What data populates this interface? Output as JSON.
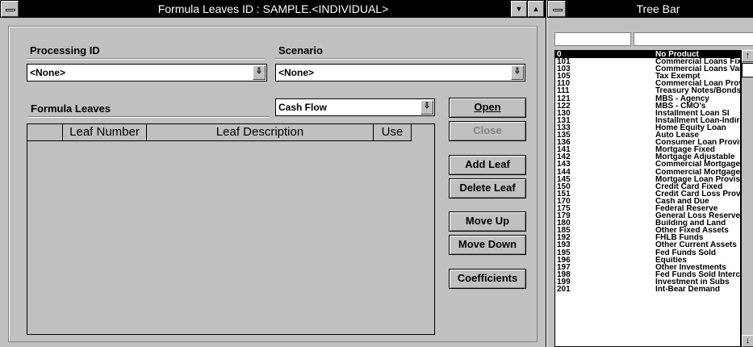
{
  "main_window": {
    "title": "Formula Leaves ID : SAMPLE.<INDIVIDUAL>",
    "sys_icon": "window-menu-icon",
    "minimize_glyph": "▼",
    "maximize_glyph": "▲"
  },
  "form": {
    "processing_id_label": "Processing ID",
    "processing_id_value": "<None>",
    "scenario_label": "Scenario",
    "scenario_value": "<None>",
    "formula_leaves_label": "Formula Leaves",
    "formula_type_value": "Cash Flow",
    "dropdown_glyph": "⇩"
  },
  "grid": {
    "columns": [
      "",
      "Leaf Number",
      "Leaf Description",
      "Use"
    ]
  },
  "buttons": {
    "open": "Open",
    "close": "Close",
    "add_leaf": "Add Leaf",
    "delete_leaf": "Delete Leaf",
    "move_up": "Move Up",
    "move_down": "Move Down",
    "coefficients": "Coefficients"
  },
  "tree_bar": {
    "title": "Tree Bar",
    "sys_icon": "window-menu-icon",
    "filter_code": "",
    "filter_desc": "",
    "selected_index": 0,
    "items": [
      {
        "code": "0",
        "desc": "No Product"
      },
      {
        "code": "101",
        "desc": "Commercial Loans Fixe"
      },
      {
        "code": "103",
        "desc": "Commercial Loans Var"
      },
      {
        "code": "105",
        "desc": "Tax Exempt"
      },
      {
        "code": "110",
        "desc": "Commercial Loan Prov"
      },
      {
        "code": "111",
        "desc": "Treasury Notes/Bonds"
      },
      {
        "code": "121",
        "desc": "MBS - Agency"
      },
      {
        "code": "122",
        "desc": "MBS - CMO's"
      },
      {
        "code": "130",
        "desc": "Installment Loan SI"
      },
      {
        "code": "131",
        "desc": "Installment Loan-Indire"
      },
      {
        "code": "133",
        "desc": "Home Equity Loan"
      },
      {
        "code": "135",
        "desc": "Auto Lease"
      },
      {
        "code": "136",
        "desc": "Consumer Loan Provis"
      },
      {
        "code": "141",
        "desc": "Mortgage Fixed"
      },
      {
        "code": "142",
        "desc": "Mortgage  Adjustable"
      },
      {
        "code": "143",
        "desc": "Commercial Mortgages"
      },
      {
        "code": "144",
        "desc": "Commercial Mortgages"
      },
      {
        "code": "145",
        "desc": "Mortgage Loan Provisi"
      },
      {
        "code": "150",
        "desc": "Credit Card Fixed"
      },
      {
        "code": "151",
        "desc": "Credit Card Loss Provi"
      },
      {
        "code": "170",
        "desc": "Cash and Due"
      },
      {
        "code": "175",
        "desc": "Federal Reserve"
      },
      {
        "code": "179",
        "desc": "General Loss Reserve"
      },
      {
        "code": "180",
        "desc": "Building and Land"
      },
      {
        "code": "185",
        "desc": "Other Fixed Assets"
      },
      {
        "code": "192",
        "desc": "FHLB Funds"
      },
      {
        "code": "193",
        "desc": "Other Current Assets"
      },
      {
        "code": "195",
        "desc": "Fed Funds Sold"
      },
      {
        "code": "196",
        "desc": "Equities"
      },
      {
        "code": "197",
        "desc": "Other Investments"
      },
      {
        "code": "198",
        "desc": "Fed Funds Sold Interc"
      },
      {
        "code": "199",
        "desc": "Investment in Subs"
      },
      {
        "code": "201",
        "desc": "Int-Bear Demand"
      }
    ],
    "scroll_up_glyph": "↑",
    "scroll_down_glyph": "↓"
  }
}
